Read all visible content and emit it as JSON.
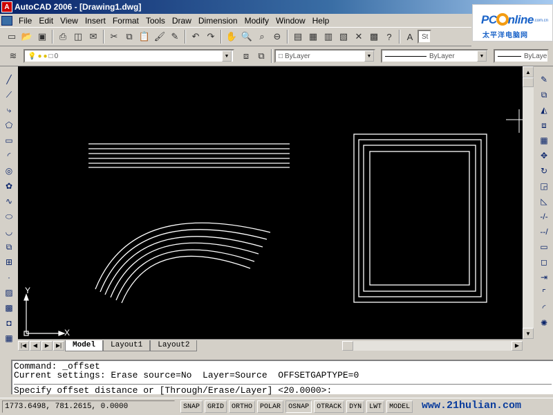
{
  "window": {
    "title": "AutoCAD 2006 - [Drawing1.dwg]"
  },
  "logo": {
    "brand_pre": "PC",
    "brand_post": "nline",
    "tld": ".com.cn",
    "subtitle": "太平洋电脑网"
  },
  "menu": [
    "File",
    "Edit",
    "View",
    "Insert",
    "Format",
    "Tools",
    "Draw",
    "Dimension",
    "Modify",
    "Window",
    "Help"
  ],
  "toolbar": {
    "style_input_placeholder": "St"
  },
  "layer": {
    "current": "0"
  },
  "properties": {
    "color": "ByLayer",
    "linetype": "ByLayer",
    "lineweight": "ByLayer"
  },
  "ucs": {
    "x_label": "X",
    "y_label": "Y"
  },
  "tabs": [
    "Model",
    "Layout1",
    "Layout2"
  ],
  "command": {
    "line1": "Command: _offset",
    "line2": "Current settings: Erase source=No  Layer=Source  OFFSETGAPTYPE=0",
    "prompt": "Specify offset distance or [Through/Erase/Layer] <20.0000>:"
  },
  "status": {
    "coords": "1773.6498, 781.2615, 0.0000",
    "buttons": [
      "SNAP",
      "GRID",
      "ORTHO",
      "POLAR",
      "OSNAP",
      "OTRACK",
      "DYN",
      "LWT",
      "MODEL"
    ],
    "watermark": "www.21hulian.com"
  }
}
